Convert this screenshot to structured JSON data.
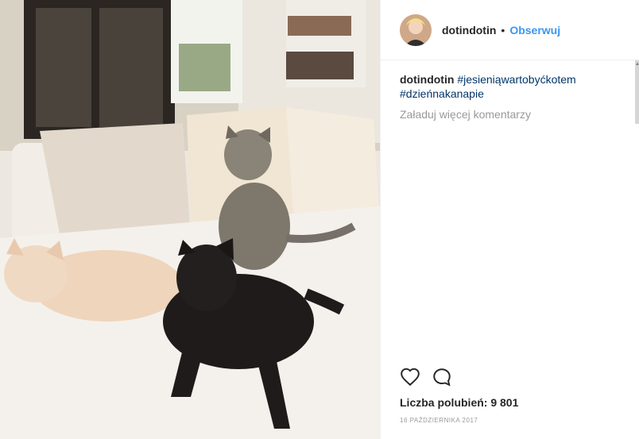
{
  "post": {
    "author": "dotindotin",
    "separator": "•",
    "follow_label": "Obserwuj",
    "caption_user": "dotindotin",
    "hashtags": [
      "#jesieniąwartobyćkotem",
      "#dzieńnakanapie"
    ],
    "load_more_label": "Załaduj więcej komentarzy",
    "likes_text": "Liczba polubień: 9 801",
    "date": "16 PAŹDZIERNIKA 2017"
  },
  "photo": {
    "description_icons": [
      "sofa",
      "cat-black",
      "cat-tabby",
      "cat-cream"
    ]
  },
  "colors": {
    "link": "#3897f0",
    "hashtag": "#003569",
    "text": "#262626",
    "muted": "#999999"
  }
}
